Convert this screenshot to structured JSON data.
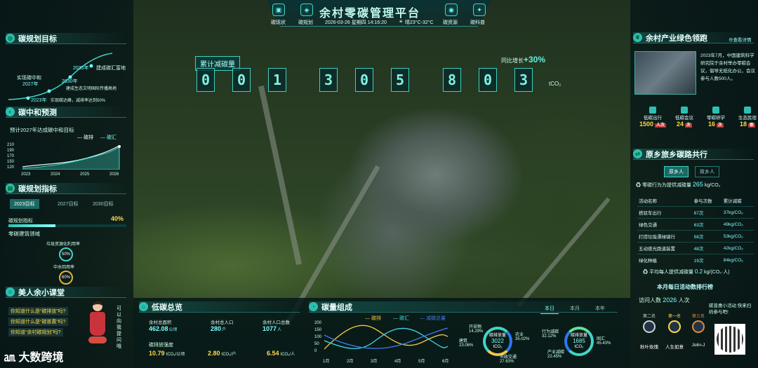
{
  "header": {
    "title": "余村零碳管理平台",
    "nav": [
      "碳现状",
      "碳规划",
      "碳资源",
      "碳科普"
    ],
    "datetime": "2026-03-26 星期四 14:16:20",
    "weather": "晴23°C-32°C"
  },
  "counter": {
    "label": "累计减碳量",
    "digits": [
      "0",
      "0",
      "1",
      "3",
      "0",
      "5",
      "8",
      "0",
      "3"
    ],
    "unit": "tCO₂",
    "growth_label": "同比增长",
    "growth": "+30%"
  },
  "left": {
    "goals": {
      "title": "碳规划目标",
      "items": [
        {
          "year": "2035年",
          "text": "建成碳汇富地"
        },
        {
          "year": "2030年",
          "text": "建成生态文明国际传播高地"
        },
        {
          "year": "2027年",
          "text": "实现碳中和"
        },
        {
          "year": "2023年",
          "text": "实现碳达峰，减排率达到50%"
        }
      ]
    },
    "forecast": {
      "title": "碳中和预测",
      "subtitle": "预计2027年达成碳中和目标",
      "legend": [
        "碳排",
        "碳汇"
      ],
      "yticks": [
        "210",
        "190",
        "170",
        "150",
        "120"
      ],
      "xticks": [
        "2023",
        "2024",
        "2025",
        "2026"
      ]
    },
    "plan": {
      "title": "碳规划指标",
      "tabs": [
        "2023目标",
        "2027目标",
        "2030目标"
      ],
      "metric": "碳规划指标",
      "metric_pct": "40%",
      "metric_value": 0.4,
      "domain": "零碳建筑领域",
      "r1_label": "垃圾资源化利用率",
      "r1": "50%",
      "r2_label": "中水回用率",
      "r2": "60%"
    },
    "class": {
      "title": "美人余小课堂",
      "q": [
        "你知道什么是“碳排放”吗?",
        "你知道什么是“碳普惠”吗?",
        "你知道“余村碳规划”吗?"
      ],
      "side": "可以向我提问哦"
    }
  },
  "right": {
    "news": {
      "title": "余村产业绿色领跑",
      "more": "查看详情",
      "text": "2023年7月，中国建筑科学研究院于余村举办零碳会议，倡导无纸化办公，会议参与人数500人。"
    },
    "stats": [
      {
        "label": "低碳出行",
        "value": "1500",
        "unit": "人次"
      },
      {
        "label": "低碳会议",
        "value": "24",
        "unit": "次"
      },
      {
        "label": "零碳研学",
        "value": "16",
        "unit": "次"
      },
      {
        "label": "生态民宿",
        "value": "18",
        "unit": "家"
      }
    ],
    "share": {
      "title": "原乡旅乡碳路共行",
      "tabs": [
        "原乡人",
        "故乡人"
      ],
      "line": "零碳行为为提供减碳量",
      "amount": "265",
      "unit": "kg/CO₂",
      "headers": [
        "活动名称",
        "参与次数",
        "累计减碳"
      ],
      "rows": [
        [
          "搭驳车出行",
          "67次",
          "37kg/CO₂"
        ],
        [
          "绿色交通",
          "63次",
          "49kg/CO₂"
        ],
        [
          "打捞垃圾漂绿骑行",
          "58次",
          "53kg/CO₂"
        ],
        [
          "五动夜光跑道装置",
          "48次",
          "42kg/CO₂"
        ],
        [
          "绿化种植",
          "19次",
          "84kg/CO₂"
        ]
      ],
      "avg_label": "平均每人提供减碳量",
      "avg": "0.2",
      "avg_unit": "kg/(CO₂·人)"
    },
    "rank": {
      "title": "本月每日活动数排行榜",
      "visits_label": "访问人数",
      "visits": "2026",
      "visits_unit": "人次",
      "side": "碳普惠小活动 快来扫码参与吧!",
      "ranks": [
        "第二名",
        "第一名",
        "第三名"
      ],
      "names": [
        "秋叶玫瑰",
        "人生如意",
        "Jolin-J"
      ]
    }
  },
  "bottom": {
    "overview": {
      "title": "低碳总览",
      "items": [
        {
          "label": "余村总面积",
          "value": "462.08",
          "unit": "公顷"
        },
        {
          "label": "余村总人口",
          "value": "280",
          "unit": "户"
        },
        {
          "label": "余村人口总数",
          "value": "1077",
          "unit": "人"
        }
      ],
      "intensity_label": "碳排放强度",
      "intensity": [
        {
          "value": "10.79",
          "unit": "tCO₂/公顷"
        },
        {
          "value": "2.80",
          "unit": "tCO₂/户"
        },
        {
          "value": "6.54",
          "unit": "tCO₂/人"
        }
      ]
    },
    "compose": {
      "title": "碳量组成",
      "tabs": [
        "本日",
        "本月",
        "本年"
      ],
      "legend": [
        "碳排",
        "碳汇",
        "减碳总量"
      ],
      "yticks": [
        "200",
        "150",
        "100",
        "50",
        "0"
      ],
      "xticks": [
        "1月",
        "2月",
        "3月",
        "4月",
        "5月",
        "6月"
      ]
    },
    "ring1": {
      "center_label": "碳排放量",
      "center": "3022",
      "unit": "tCO₂",
      "labels": [
        "开采物 14.29%",
        "农业 35.02%",
        "建筑 23.06%",
        "市政交通 27.63%"
      ]
    },
    "ring2": {
      "center_label": "碳排放量",
      "center": "1685",
      "unit": "tCO₂",
      "labels": [
        "行为减碳 32.12%",
        "固汇 45.43%",
        "产业减碳 22.45%"
      ]
    }
  },
  "brand": "大数跨境"
}
